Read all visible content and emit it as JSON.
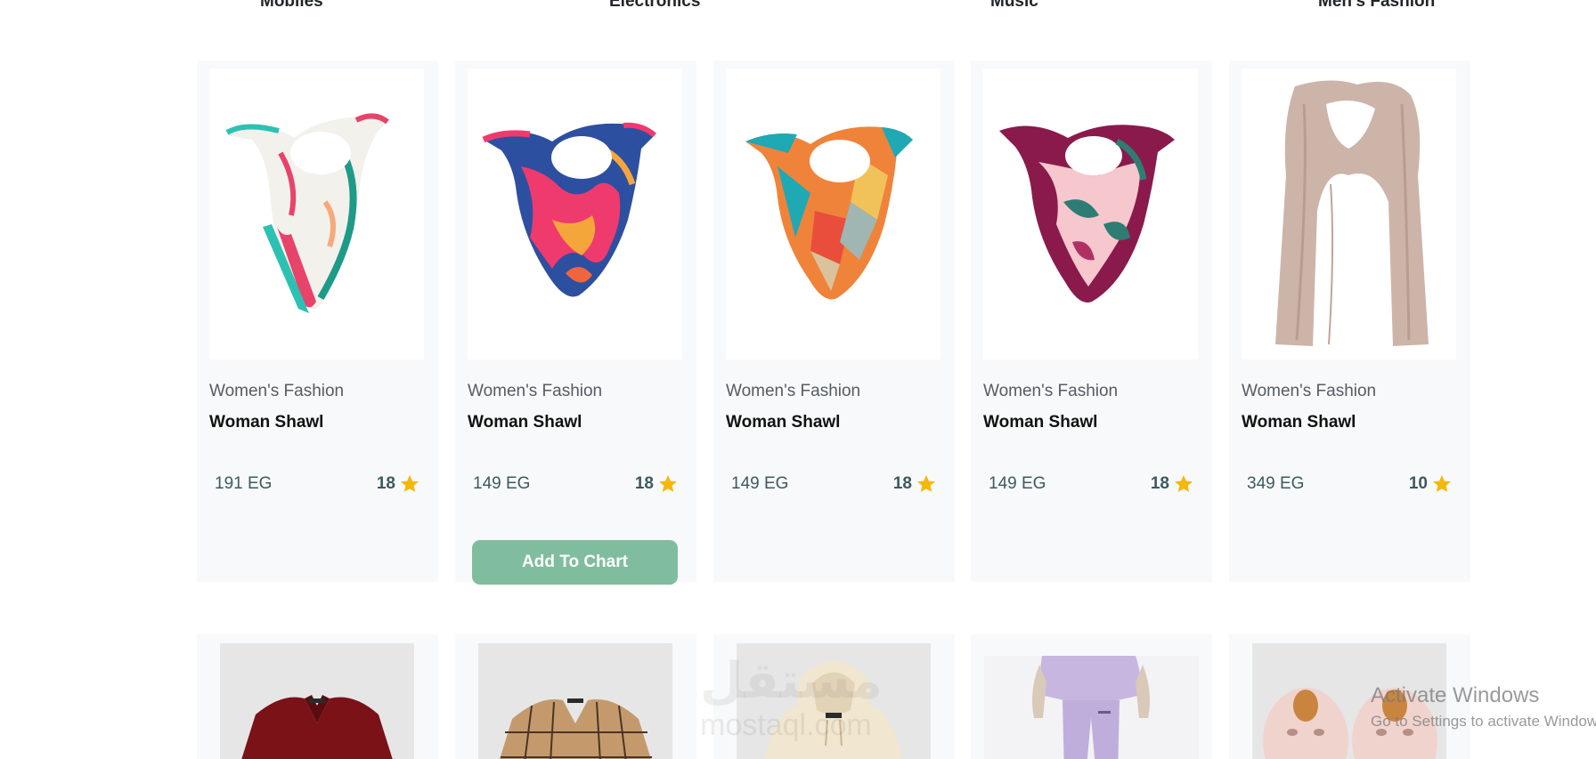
{
  "categories": [
    "Mobiles",
    "Electronics",
    "Music",
    "Men's Fashion"
  ],
  "products": [
    {
      "category": "Women's Fashion",
      "title": "Woman Shawl",
      "price": "191 EG",
      "rating": "18",
      "image": "floral-shawl-white-teal"
    },
    {
      "category": "Women's Fashion",
      "title": "Woman Shawl",
      "price": "149 EG",
      "rating": "18",
      "image": "shawl-blue-pink"
    },
    {
      "category": "Women's Fashion",
      "title": "Woman Shawl",
      "price": "149 EG",
      "rating": "18",
      "image": "shawl-teal-orange"
    },
    {
      "category": "Women's Fashion",
      "title": "Woman Shawl",
      "price": "149 EG",
      "rating": "18",
      "image": "shawl-purple-pink"
    },
    {
      "category": "Women's Fashion",
      "title": "Woman Shawl",
      "price": "349 EG",
      "rating": "10",
      "image": "long-scarf-beige"
    }
  ],
  "hovered_card_button": "Add To Chart",
  "second_row_images": [
    "red-blouse",
    "plaid-shirt",
    "cream-hoodie",
    "lavender-tracksuit",
    "pink-slippers"
  ],
  "watermark": {
    "logo": "مستقل",
    "text": "mostaql.com"
  },
  "os_overlay": {
    "title": "Activate Windows",
    "subtitle": "Go to Settings to activate Windows."
  },
  "colors": {
    "accent_button": "#80bd9e",
    "star": "#f5b70a",
    "card_bg": "#f8f9fa"
  }
}
